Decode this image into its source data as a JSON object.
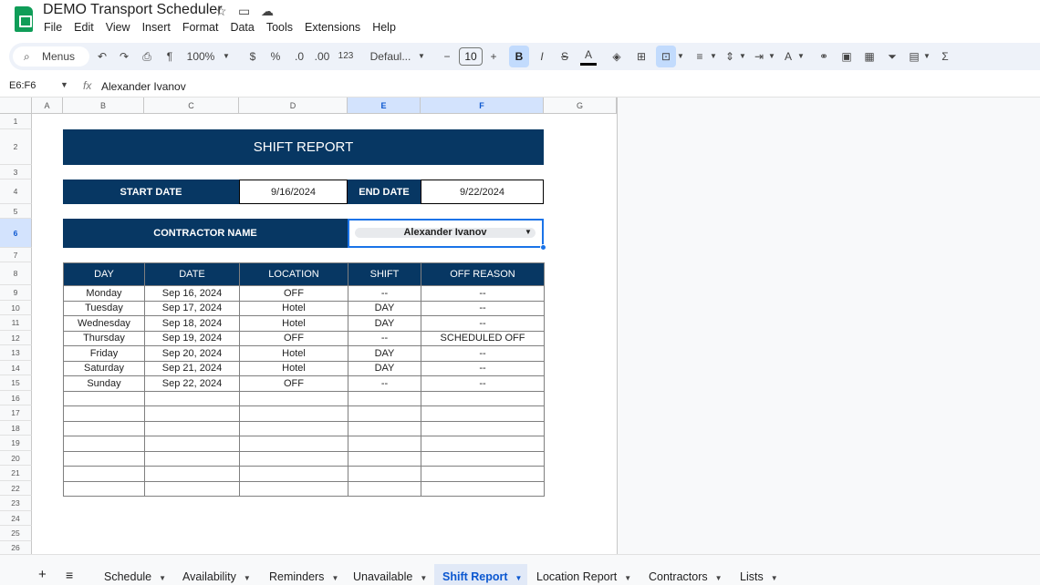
{
  "app": {
    "title": "DEMO Transport Scheduler",
    "menu": [
      "File",
      "Edit",
      "View",
      "Insert",
      "Format",
      "Data",
      "Tools",
      "Extensions",
      "Help"
    ]
  },
  "toolbar": {
    "search_label": "Menus",
    "zoom": "100%",
    "currency": "$",
    "percent": "%",
    "dec_decrease": ".0",
    "dec_increase": ".00",
    "number_format": "123",
    "font": "Defaul...",
    "font_size": "10",
    "minus": "−",
    "plus": "+",
    "bold": "B",
    "italic": "I",
    "strike": "S",
    "text_color": "A",
    "sum": "Σ"
  },
  "formula_bar": {
    "name_box": "E6:F6",
    "fx": "fx",
    "value": "Alexander Ivanov"
  },
  "grid": {
    "columns": [
      "A",
      "B",
      "C",
      "D",
      "E",
      "F",
      "G"
    ],
    "selected_columns": [
      "E",
      "F"
    ],
    "rows": [
      "1",
      "2",
      "3",
      "4",
      "5",
      "6",
      "7",
      "8",
      "9",
      "10",
      "11",
      "12",
      "13",
      "14",
      "15",
      "16",
      "17",
      "18",
      "19",
      "20",
      "21",
      "22",
      "23",
      "24",
      "25",
      "26"
    ],
    "selected_row": "6"
  },
  "report": {
    "title": "SHIFT REPORT",
    "start_date_label": "START DATE",
    "start_date": "9/16/2024",
    "end_date_label": "END DATE",
    "end_date": "9/22/2024",
    "contractor_label": "CONTRACTOR NAME",
    "contractor": "Alexander Ivanov",
    "headers": [
      "DAY",
      "DATE",
      "LOCATION",
      "SHIFT",
      "OFF REASON"
    ],
    "rows": [
      [
        "Monday",
        "Sep 16, 2024",
        "OFF",
        "--",
        "--"
      ],
      [
        "Tuesday",
        "Sep 17, 2024",
        "Hotel",
        "DAY",
        "--"
      ],
      [
        "Wednesday",
        "Sep 18, 2024",
        "Hotel",
        "DAY",
        "--"
      ],
      [
        "Thursday",
        "Sep 19, 2024",
        "OFF",
        "--",
        "SCHEDULED OFF"
      ],
      [
        "Friday",
        "Sep 20, 2024",
        "Hotel",
        "DAY",
        "--"
      ],
      [
        "Saturday",
        "Sep 21, 2024",
        "Hotel",
        "DAY",
        "--"
      ],
      [
        "Sunday",
        "Sep 22, 2024",
        "OFF",
        "--",
        "--"
      ]
    ],
    "empty_rows": 7
  },
  "sheets": {
    "add": "+",
    "all": "≡",
    "tabs": [
      "Schedule",
      "Availability",
      "Reminders",
      "Unavailable",
      "Shift Report",
      "Location Report",
      "Contractors",
      "Lists"
    ],
    "active": "Shift Report"
  },
  "colors": {
    "header_navy": "#073763",
    "selection": "#1a73e8",
    "brand_green": "#0f9d58"
  }
}
